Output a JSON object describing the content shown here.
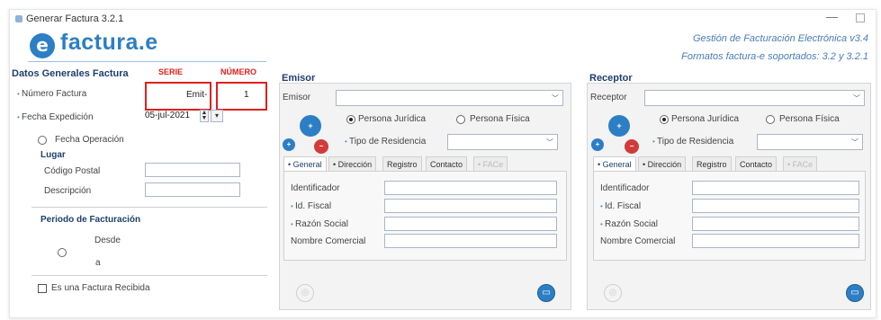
{
  "window": {
    "title": "Generar Factura 3.2.1",
    "minimize": "—"
  },
  "header": {
    "logo_mark": "e",
    "brand": "factura.e",
    "gestion": "Gestión de Facturación Electrónica v3.4",
    "formats": "Formatos factura-e soportados: 3.2 y 3.2.1"
  },
  "datos": {
    "title": "Datos Generales Factura",
    "serie_label": "SERIE",
    "numero_label": "NÚMERO",
    "numero_factura_label": "Número Factura",
    "serie_value": "Emit-",
    "numero_value": "1",
    "fecha_expedicion_label": "Fecha Expedición",
    "fecha_value": "05-jul-2021",
    "fecha_operacion_label": "Fecha Operación",
    "lugar_title": "Lugar",
    "codigo_postal_label": "Código Postal",
    "descripcion_label": "Descripción",
    "periodo_title": "Periodo de Facturación",
    "desde_label": "Desde",
    "a_label": "a",
    "recibida_label": "Es una Factura Recibida"
  },
  "emisor": {
    "title": "Emisor",
    "select_label": "Emisor",
    "juridica": "Persona Jurídica",
    "fisica": "Persona Física",
    "residencia_label": "Tipo de Residencia",
    "tabs": [
      "General",
      "Dirección",
      "Registro",
      "Contacto",
      "FACe"
    ],
    "fields": [
      "Identificador",
      "Id. Fiscal",
      "Razón Social",
      "Nombre Comercial"
    ]
  },
  "receptor": {
    "title": "Receptor",
    "select_label": "Receptor",
    "juridica": "Persona Jurídica",
    "fisica": "Persona Física",
    "residencia_label": "Tipo de Residencia",
    "tabs": [
      "General",
      "Dirección",
      "Registro",
      "Contacto",
      "FACe"
    ],
    "fields": [
      "Identificador",
      "Id. Fiscal",
      "Razón Social",
      "Nombre Comercial"
    ]
  },
  "colors": {
    "brand": "#2c7fc4",
    "section": "#1f3f6e",
    "highlight": "#e02020"
  }
}
